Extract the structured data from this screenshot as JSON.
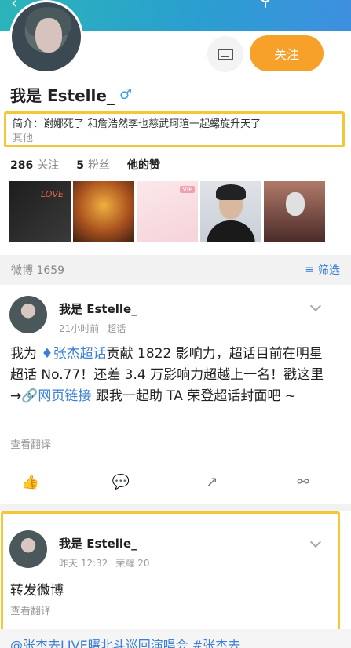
{
  "header": {
    "back_icon": "back-arrow-icon",
    "search_icon": "search-icon",
    "more_icon": "more-dots-icon"
  },
  "profile": {
    "username": "我是 Estelle_",
    "gender_icon": "male-icon",
    "follow_label": "关注",
    "bio": "简介：谢娜死了 和詹浩然李也慈武珂瑄一起螺旋升天了",
    "bio_more": "其他",
    "stats": {
      "following_count": "286",
      "following_label": "关注",
      "followers_count": "5",
      "followers_label": "粉丝",
      "liked_label": "他的赞"
    }
  },
  "feed_bar": {
    "label": "微博 1659",
    "filter_label": "筛选"
  },
  "post1": {
    "name": "我是 Estelle_",
    "time": "21小时前",
    "source": "超话",
    "body_prefix": "我为",
    "body_link1": "张杰超话",
    "body_mid": "贡献 1822 影响力，超话目前在明星超话 No.77！还差 3.4 万影响力超越上一名！戳这里 →",
    "body_link2": "网页链接",
    "body_suffix": " 跟我一起助 TA 荣登超话封面吧 ~",
    "see_translate": "查看翻译"
  },
  "post2": {
    "name": "我是 Estelle_",
    "time": "昨天 12:32",
    "source": "荣耀 20",
    "text": "转发微博",
    "see_translate": "查看翻译",
    "quote": "@张杰去LIVE曙北斗巡回演唱会 #张杰去"
  }
}
